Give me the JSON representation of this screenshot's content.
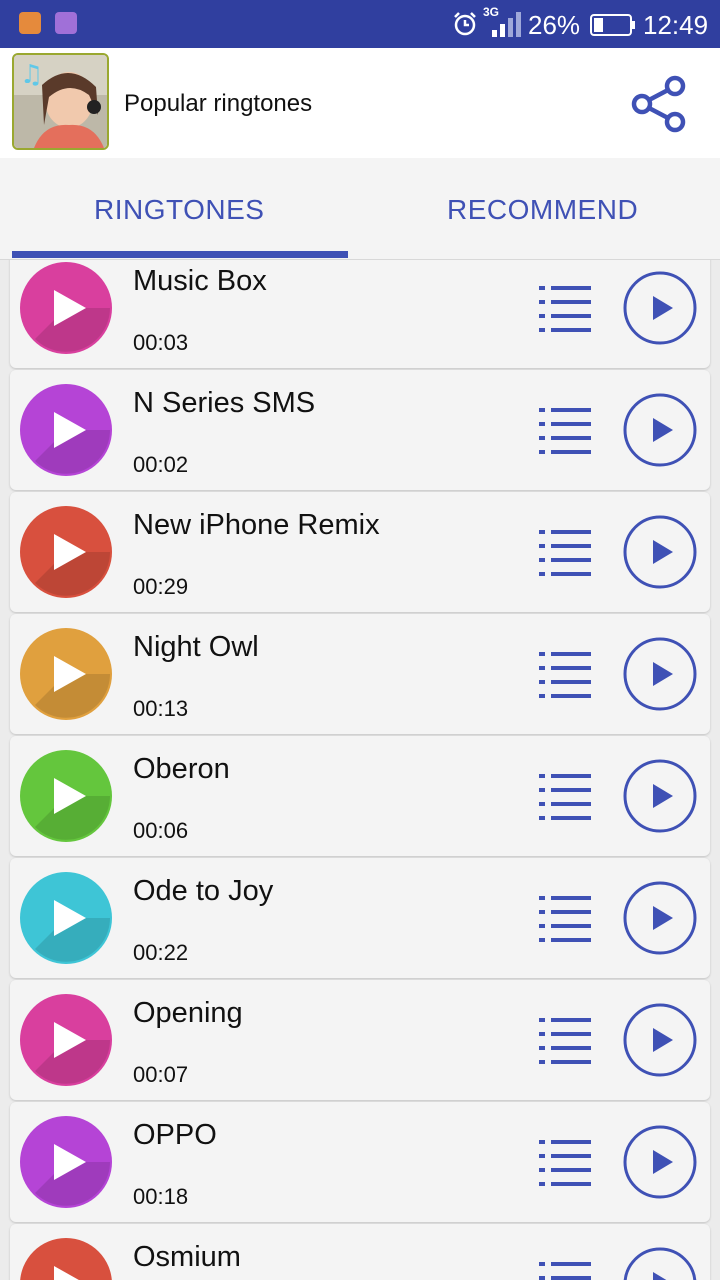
{
  "status_bar": {
    "network": "3G",
    "battery": "26%",
    "battery_level": 0.26,
    "time": "12:49"
  },
  "header": {
    "title": "Popular ringtones",
    "share_icon": "share-icon"
  },
  "tabs": [
    {
      "label": "RINGTONES",
      "active": true
    },
    {
      "label": "RECOMMEND",
      "active": false
    }
  ],
  "colors": {
    "primary": "#3f51b5",
    "status_bar": "#303f9f"
  },
  "ringtones": [
    {
      "title": "Music Box",
      "duration": "00:03",
      "color": "#d93f9e"
    },
    {
      "title": "N Series SMS",
      "duration": "00:02",
      "color": "#b544d6"
    },
    {
      "title": "New iPhone Remix",
      "duration": "00:29",
      "color": "#d8503e"
    },
    {
      "title": "Night Owl",
      "duration": "00:13",
      "color": "#e0a03e"
    },
    {
      "title": "Oberon",
      "duration": "00:06",
      "color": "#64c63d"
    },
    {
      "title": "Ode to Joy",
      "duration": "00:22",
      "color": "#3ec5d6"
    },
    {
      "title": "Opening",
      "duration": "00:07",
      "color": "#d93f9e"
    },
    {
      "title": "OPPO",
      "duration": "00:18",
      "color": "#b544d6"
    },
    {
      "title": "Osmium",
      "duration": "",
      "color": "#d8503e"
    }
  ]
}
